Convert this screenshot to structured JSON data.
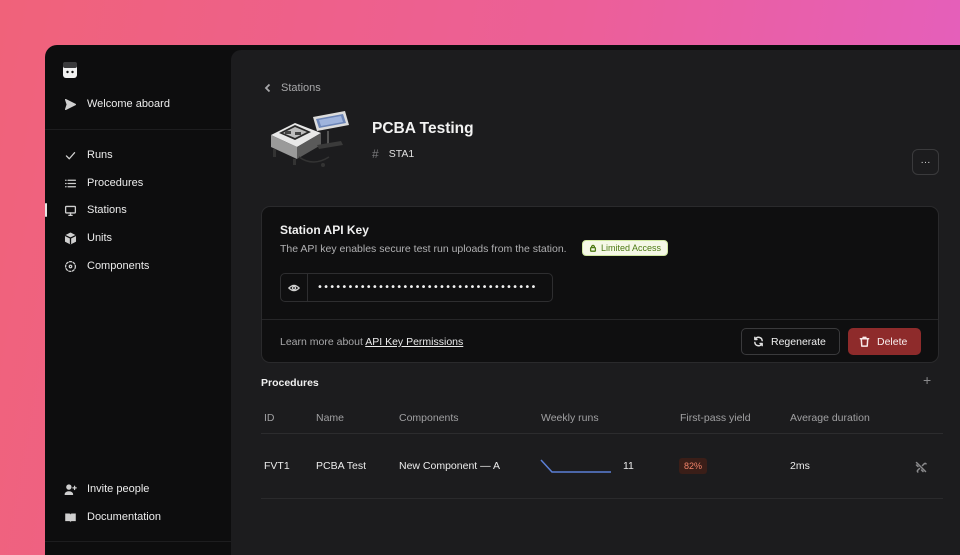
{
  "sidebar": {
    "welcome_label": "Welcome aboard",
    "items": [
      {
        "label": "Runs",
        "icon": "check-icon"
      },
      {
        "label": "Procedures",
        "icon": "list-icon"
      },
      {
        "label": "Stations",
        "icon": "monitor-icon"
      },
      {
        "label": "Units",
        "icon": "cube-icon"
      },
      {
        "label": "Components",
        "icon": "component-icon"
      }
    ],
    "active_item": "Stations",
    "bottom": [
      {
        "label": "Invite people",
        "icon": "user-plus-icon"
      },
      {
        "label": "Documentation",
        "icon": "book-icon"
      }
    ]
  },
  "breadcrumb": {
    "label": "Stations"
  },
  "station": {
    "title": "PCBA Testing",
    "id_prefix": "#",
    "id": "STA1"
  },
  "more_button": {
    "label": "···"
  },
  "api_card": {
    "title": "Station API Key",
    "description": "The API key enables secure test run uploads from the station.",
    "badge": "Limited Access",
    "key_masked": "••••••••••••••••••••••••••••••••••••",
    "learn_prefix": "Learn more about ",
    "learn_link": "API Key Permissions",
    "regenerate_label": "Regenerate",
    "delete_label": "Delete"
  },
  "procedures": {
    "title": "Procedures",
    "add_label": "+",
    "columns": [
      "ID",
      "Name",
      "Components",
      "Weekly runs",
      "First-pass yield",
      "Average duration"
    ],
    "rows": [
      {
        "id": "FVT1",
        "name": "PCBA Test",
        "components": "New Component — A",
        "weekly_runs": "11",
        "first_pass_yield": "82%",
        "average_duration": "2ms"
      }
    ]
  },
  "colors": {
    "background_gradient": [
      "#f0627a",
      "#e35fc2"
    ],
    "delete_button": "#8e2b2b",
    "badge_green": "#4d7a14",
    "yield_badge": "#f0836a",
    "sparkline": "#5b7fd6"
  }
}
